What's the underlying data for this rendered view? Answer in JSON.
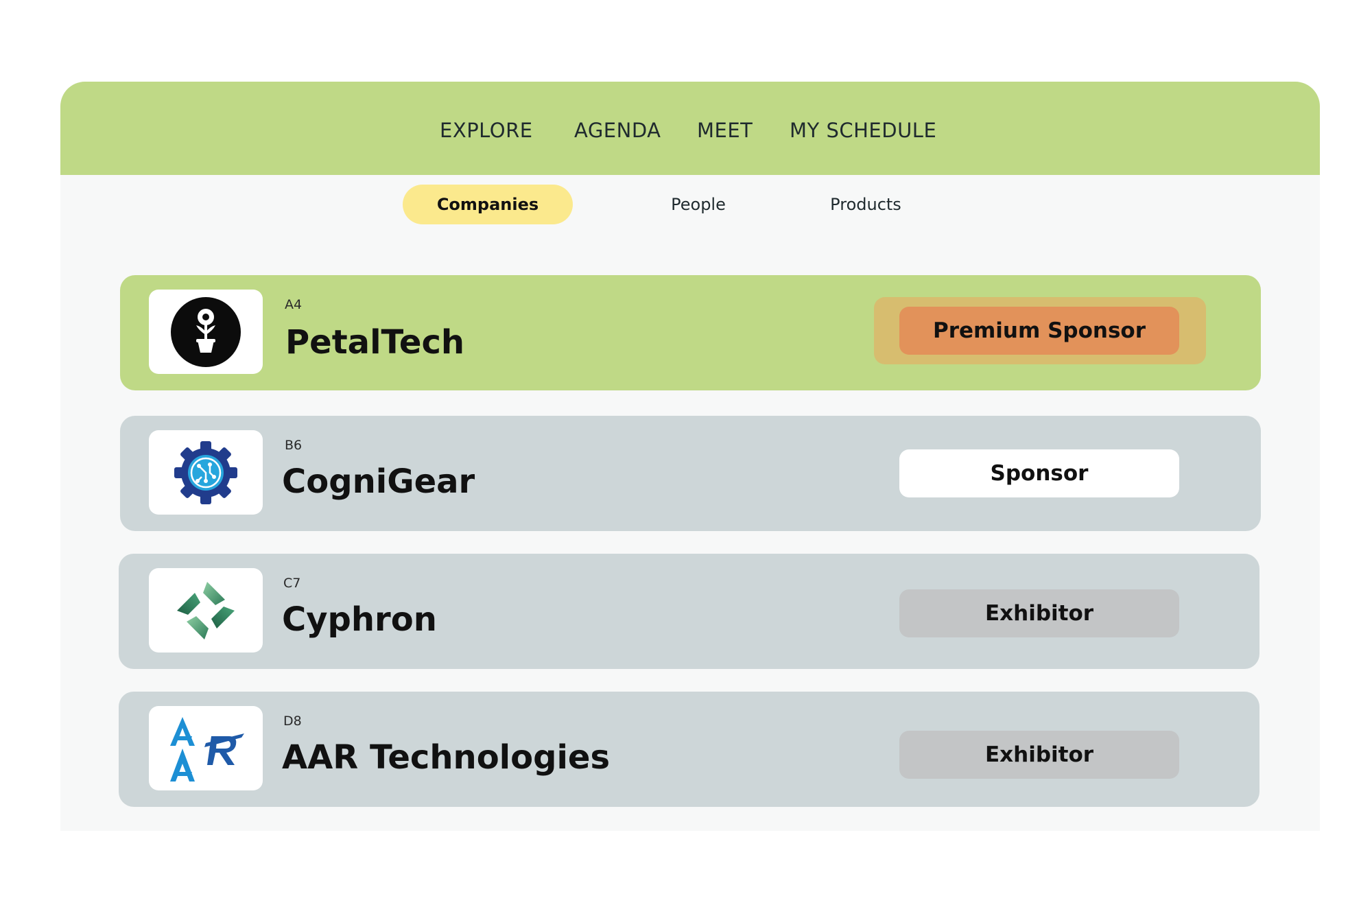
{
  "nav": {
    "items": [
      {
        "label": "EXPLORE"
      },
      {
        "label": "AGENDA"
      },
      {
        "label": "MEET"
      },
      {
        "label": "MY SCHEDULE"
      }
    ]
  },
  "tabs": [
    {
      "label": "Companies",
      "active": true
    },
    {
      "label": "People",
      "active": false
    },
    {
      "label": "Products",
      "active": false
    }
  ],
  "companies": [
    {
      "booth": "A4",
      "name": "PetalTech",
      "tier": "Premium Sponsor",
      "logo": "flower-pot-icon",
      "row_color": "#bfd986",
      "badge_color": "#e2925a"
    },
    {
      "booth": "B6",
      "name": "CogniGear",
      "tier": "Sponsor",
      "logo": "gear-circuit-icon",
      "row_color": "#cdd6d8",
      "badge_color": "#ffffff"
    },
    {
      "booth": "C7",
      "name": "Cyphron",
      "tier": "Exhibitor",
      "logo": "twisted-diamond-icon",
      "row_color": "#cdd6d8",
      "badge_color": "#c3c5c6"
    },
    {
      "booth": "D8",
      "name": "AAR Technologies",
      "tier": "Exhibitor",
      "logo": "aar-letters-icon",
      "row_color": "#cdd6d8",
      "badge_color": "#c3c5c6"
    }
  ],
  "colors": {
    "header": "#bfd986",
    "active_tab": "#fbe98d",
    "premium_badge_halo": "#d7bd6f"
  }
}
